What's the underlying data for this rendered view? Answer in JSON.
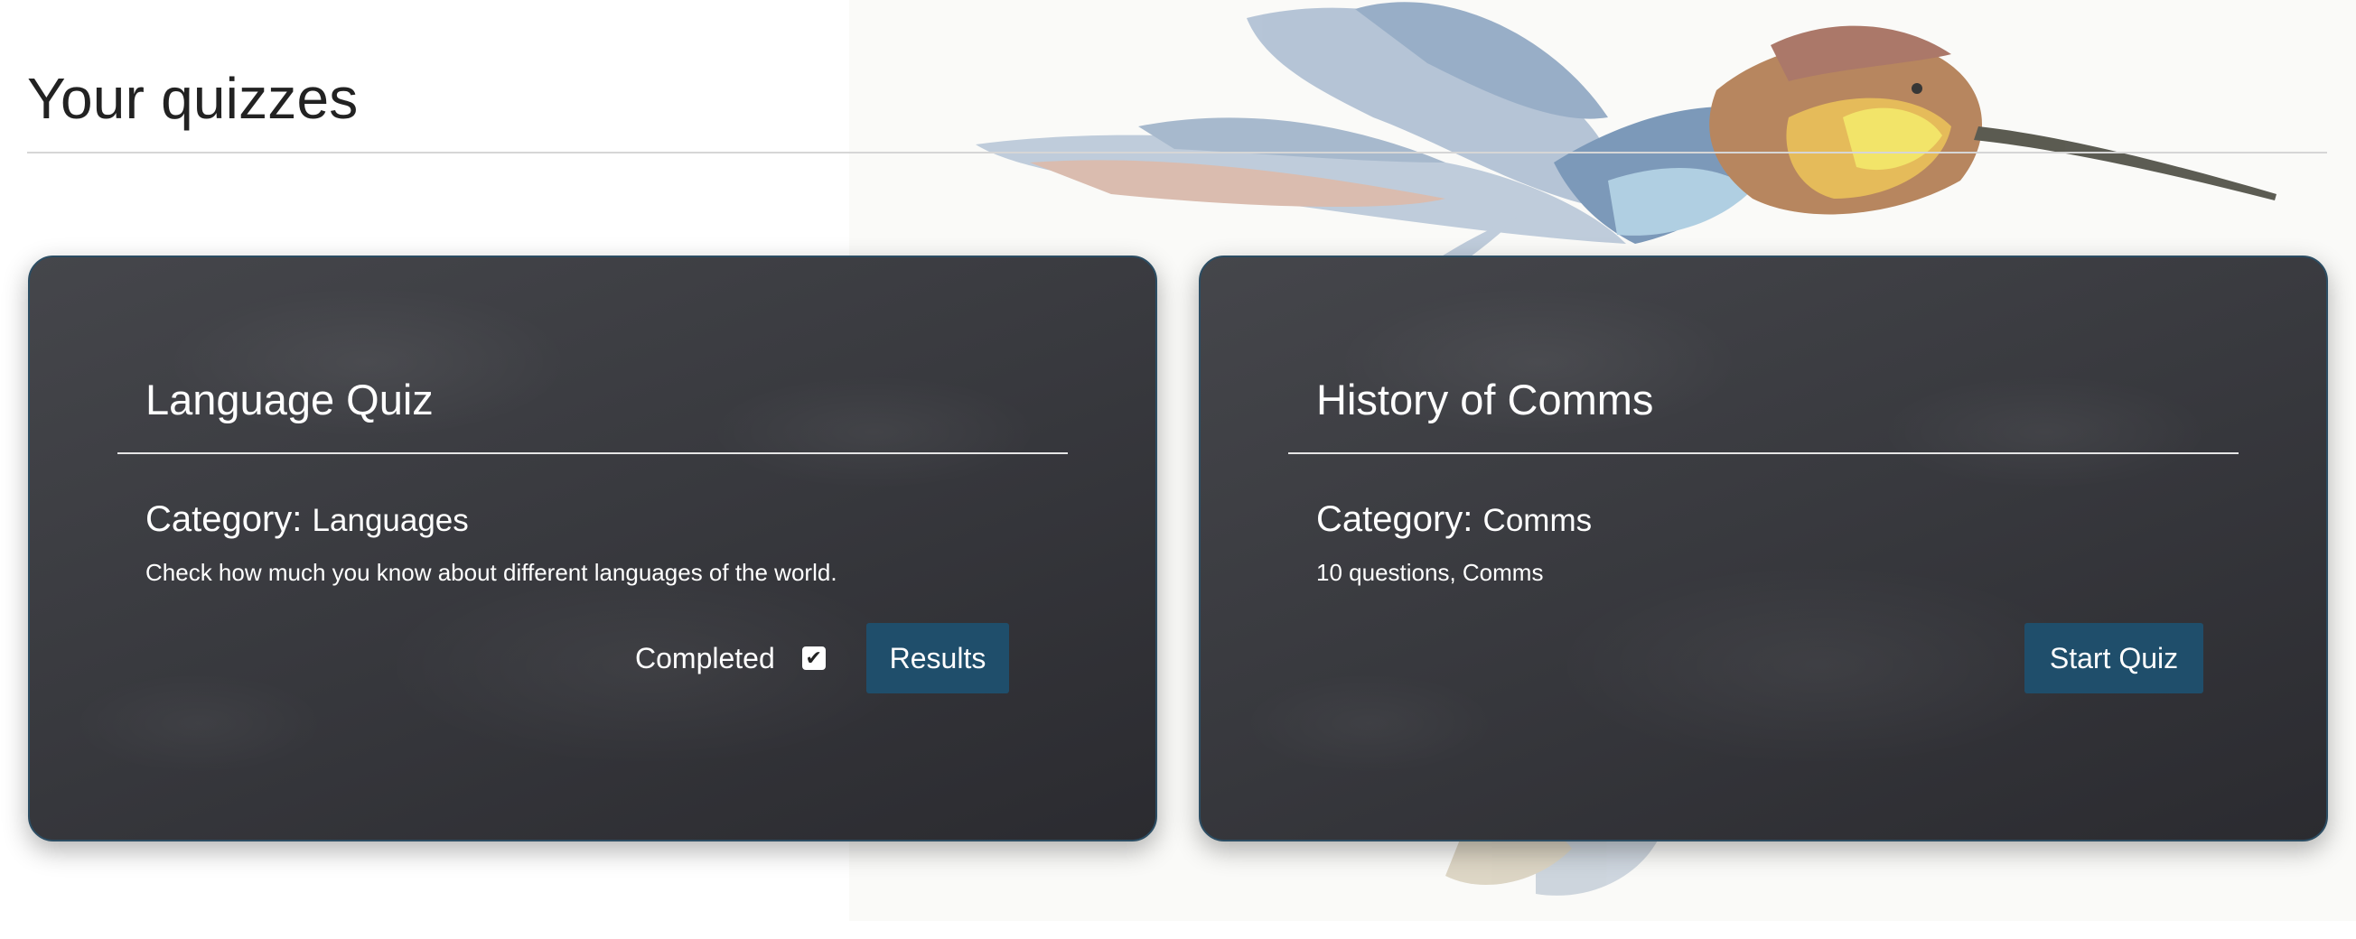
{
  "page": {
    "title": "Your quizzes"
  },
  "quizzes": [
    {
      "title": "Language Quiz",
      "category_label": "Category:",
      "category": "Languages",
      "description": "Check how much you know about different languages of the world.",
      "completed_label": "Completed",
      "completed": true,
      "action_label": "Results"
    },
    {
      "title": "History of Comms",
      "category_label": "Category:",
      "category": "Comms",
      "description": "10 questions, Comms",
      "completed": false,
      "action_label": "Start Quiz"
    }
  ],
  "colors": {
    "button": "#1f4e6b",
    "card_border": "#2c4d63",
    "card_background": "#393a3f"
  },
  "icons": {
    "checkbox": "checkmark-icon",
    "background": "hummingbird-illustration"
  }
}
